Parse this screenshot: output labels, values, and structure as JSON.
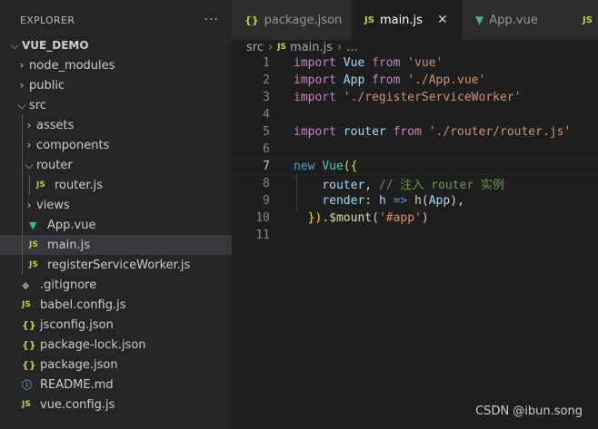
{
  "explorer": {
    "title": "EXPLORER",
    "more": "···",
    "tree": [
      {
        "label": "VUE_DEMO",
        "chevron": "⌵",
        "icon": "",
        "icon_kind": "",
        "depth": 0,
        "root": true
      },
      {
        "label": "node_modules",
        "chevron": "›",
        "icon": "",
        "icon_kind": "",
        "depth": 1
      },
      {
        "label": "public",
        "chevron": "›",
        "icon": "",
        "icon_kind": "",
        "depth": 1
      },
      {
        "label": "src",
        "chevron": "⌵",
        "icon": "",
        "icon_kind": "",
        "depth": 1
      },
      {
        "label": "assets",
        "chevron": "›",
        "icon": "",
        "icon_kind": "",
        "depth": 2
      },
      {
        "label": "components",
        "chevron": "›",
        "icon": "",
        "icon_kind": "",
        "depth": 2
      },
      {
        "label": "router",
        "chevron": "⌵",
        "icon": "",
        "icon_kind": "",
        "depth": 2
      },
      {
        "label": "router.js",
        "chevron": "",
        "icon": "JS",
        "icon_kind": "js",
        "depth": 3
      },
      {
        "label": "views",
        "chevron": "›",
        "icon": "",
        "icon_kind": "",
        "depth": 2
      },
      {
        "label": "App.vue",
        "chevron": "",
        "icon": "▼",
        "icon_kind": "vue",
        "depth": 2
      },
      {
        "label": "main.js",
        "chevron": "",
        "icon": "JS",
        "icon_kind": "js",
        "depth": 2,
        "selected": true
      },
      {
        "label": "registerServiceWorker.js",
        "chevron": "",
        "icon": "JS",
        "icon_kind": "js",
        "depth": 2
      },
      {
        "label": ".gitignore",
        "chevron": "",
        "icon": "◆",
        "icon_kind": "git",
        "depth": 1
      },
      {
        "label": "babel.config.js",
        "chevron": "",
        "icon": "JS",
        "icon_kind": "js",
        "depth": 1
      },
      {
        "label": "jsconfig.json",
        "chevron": "",
        "icon": "{}",
        "icon_kind": "json",
        "depth": 1
      },
      {
        "label": "package-lock.json",
        "chevron": "",
        "icon": "{}",
        "icon_kind": "json",
        "depth": 1
      },
      {
        "label": "package.json",
        "chevron": "",
        "icon": "{}",
        "icon_kind": "json",
        "depth": 1
      },
      {
        "label": "README.md",
        "chevron": "",
        "icon": "ⓘ",
        "icon_kind": "info",
        "depth": 1
      },
      {
        "label": "vue.config.js",
        "chevron": "",
        "icon": "JS",
        "icon_kind": "js",
        "depth": 1
      }
    ]
  },
  "tabs": [
    {
      "label": "package.json",
      "icon": "{}",
      "icon_kind": "json",
      "active": false,
      "close": ""
    },
    {
      "label": "main.js",
      "icon": "JS",
      "icon_kind": "js",
      "active": true,
      "close": "✕"
    },
    {
      "label": "App.vue",
      "icon": "▼",
      "icon_kind": "vue",
      "active": false,
      "close": ""
    },
    {
      "label": "",
      "icon": "JS",
      "icon_kind": "js",
      "active": false,
      "close": ""
    }
  ],
  "breadcrumb": {
    "folder": "src",
    "sep": "›",
    "file_icon": "JS",
    "file": "main.js",
    "ellipsis": "..."
  },
  "editor": {
    "current_line": 7,
    "lines": [
      {
        "n": "1",
        "tokens": [
          [
            "kw",
            "import"
          ],
          [
            "pun",
            " "
          ],
          [
            "id",
            "Vue"
          ],
          [
            "pun",
            " "
          ],
          [
            "kw",
            "from"
          ],
          [
            "pun",
            " "
          ],
          [
            "str",
            "'vue'"
          ]
        ]
      },
      {
        "n": "2",
        "tokens": [
          [
            "kw",
            "import"
          ],
          [
            "pun",
            " "
          ],
          [
            "id",
            "App"
          ],
          [
            "pun",
            " "
          ],
          [
            "kw",
            "from"
          ],
          [
            "pun",
            " "
          ],
          [
            "str",
            "'./App.vue'"
          ]
        ]
      },
      {
        "n": "3",
        "tokens": [
          [
            "kw",
            "import"
          ],
          [
            "pun",
            " "
          ],
          [
            "str",
            "'./registerServiceWorker'"
          ]
        ]
      },
      {
        "n": "4",
        "tokens": []
      },
      {
        "n": "5",
        "tokens": [
          [
            "kw",
            "import"
          ],
          [
            "pun",
            " "
          ],
          [
            "id",
            "router"
          ],
          [
            "pun",
            " "
          ],
          [
            "kw",
            "from"
          ],
          [
            "pun",
            " "
          ],
          [
            "str",
            "'./router/router.js'"
          ]
        ]
      },
      {
        "n": "6",
        "tokens": []
      },
      {
        "n": "7",
        "tokens": [
          [
            "k",
            "new"
          ],
          [
            "pun",
            " "
          ],
          [
            "cls",
            "Vue"
          ],
          [
            "br",
            "({"
          ]
        ]
      },
      {
        "n": "8",
        "tokens": [
          [
            "pun",
            "    "
          ],
          [
            "id",
            "router"
          ],
          [
            "pun",
            ", "
          ],
          [
            "cm",
            "// 注入 router 实例"
          ]
        ],
        "guide": true
      },
      {
        "n": "9",
        "tokens": [
          [
            "pun",
            "    "
          ],
          [
            "id",
            "render"
          ],
          [
            "pun",
            ": "
          ],
          [
            "id",
            "h"
          ],
          [
            "pun",
            " "
          ],
          [
            "k",
            "=>"
          ],
          [
            "pun",
            " "
          ],
          [
            "fn",
            "h"
          ],
          [
            "pun",
            "("
          ],
          [
            "id",
            "App"
          ],
          [
            "pun",
            "),"
          ]
        ],
        "guide": true
      },
      {
        "n": "10",
        "tokens": [
          [
            "pun",
            "  "
          ],
          [
            "br",
            "})"
          ],
          [
            "pun",
            "."
          ],
          [
            "fn",
            "$mount"
          ],
          [
            "pun",
            "("
          ],
          [
            "str",
            "'#app'"
          ],
          [
            "pun",
            ")"
          ]
        ]
      },
      {
        "n": "11",
        "tokens": []
      }
    ]
  },
  "watermark": "CSDN @ibun.song"
}
